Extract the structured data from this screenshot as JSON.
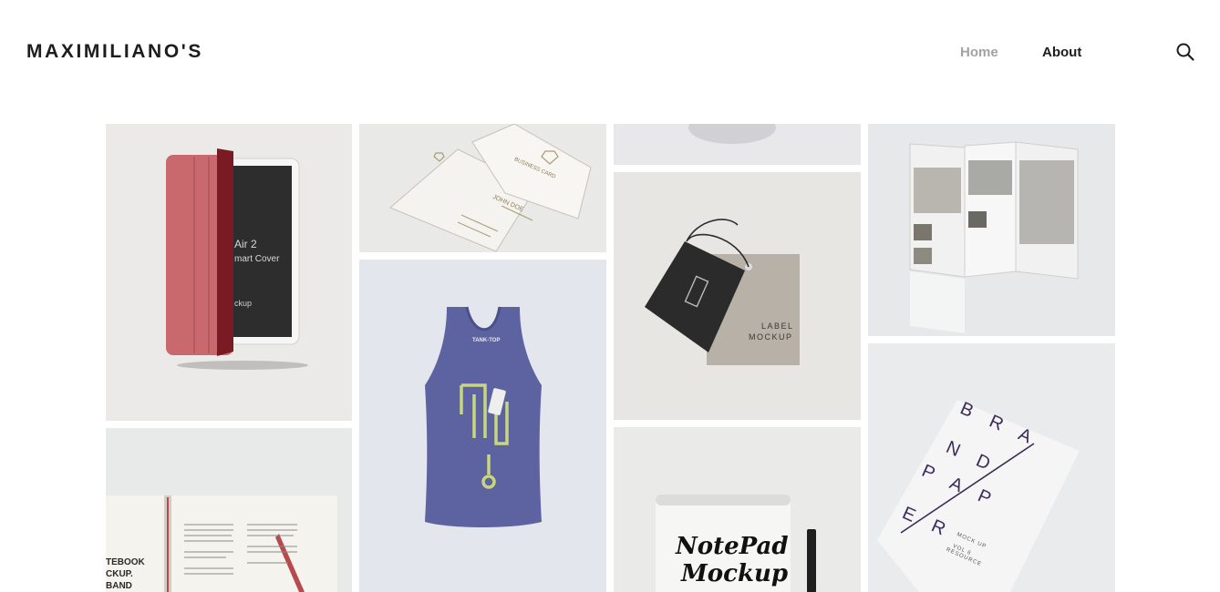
{
  "site": {
    "logo": "MAXIMILIANO'S",
    "nav": [
      {
        "label": "Home",
        "active": true
      },
      {
        "label": "About",
        "active": false
      }
    ],
    "search_icon": "search-icon"
  },
  "colors": {
    "nav_active": "#a2a2a2",
    "nav_default": "#1d1d1d",
    "tank_top": "#5c63a0",
    "tablet_cover": "#c9686d"
  },
  "gallery": {
    "ipad": {
      "line1": "Air 2",
      "line2": "mart Cover",
      "line3": "ckup"
    },
    "business_card": {
      "title": "BUSINESS CARD",
      "name": "JOHN DOE"
    },
    "tank_top": {
      "tag": "TANK-TOP"
    },
    "label": {
      "line1": "LABEL",
      "line2": "MOCKUP"
    },
    "notebook": {
      "line1": "TEBOOK",
      "line2": "CKUP.",
      "line3": "BAND"
    },
    "notepad": {
      "line1": "NotePad",
      "line2": "Mockup"
    },
    "brand_paper": {
      "l1": "B R A",
      "l2": "N D",
      "l3": "P A P",
      "l4": "E R",
      "sub1": "MOCK UP",
      "sub2": "VOL 6",
      "sub3": "RESOURCE"
    }
  }
}
